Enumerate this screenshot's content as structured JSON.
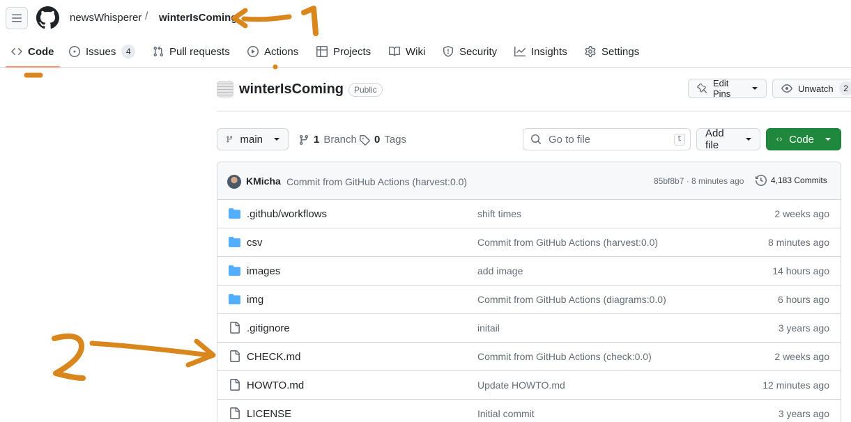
{
  "header": {
    "owner": "newsWhisperer",
    "separator": "/",
    "repo": "winterIsComing"
  },
  "tabs": [
    {
      "label": "Code",
      "icon": "code-icon",
      "selected": true
    },
    {
      "label": "Issues",
      "icon": "issue-icon",
      "count": "4"
    },
    {
      "label": "Pull requests",
      "icon": "pull-request-icon"
    },
    {
      "label": "Actions",
      "icon": "play-icon"
    },
    {
      "label": "Projects",
      "icon": "table-icon"
    },
    {
      "label": "Wiki",
      "icon": "book-icon"
    },
    {
      "label": "Security",
      "icon": "shield-icon"
    },
    {
      "label": "Insights",
      "icon": "graph-icon"
    },
    {
      "label": "Settings",
      "icon": "gear-icon"
    }
  ],
  "repo_header": {
    "title": "winterIsComing",
    "visibility": "Public",
    "edit_pins": "Edit Pins",
    "unwatch": "Unwatch",
    "watch_count": "2"
  },
  "file_nav": {
    "branch": "main",
    "branch_count": "1",
    "branch_label": "Branch",
    "tag_count": "0",
    "tag_label": "Tags",
    "go_to_file_placeholder": "Go to file",
    "shortcut_key": "t",
    "add_file": "Add file",
    "code": "Code"
  },
  "latest_commit": {
    "user": "KMicha",
    "message": "Commit from GitHub Actions (harvest:0.0)",
    "sha_time": "85bf8b7 · 8 minutes ago",
    "commits": "4,183 Commits"
  },
  "files": [
    {
      "type": "folder",
      "name": ".github/workflows",
      "message": "shift times",
      "age": "2 weeks ago"
    },
    {
      "type": "folder",
      "name": "csv",
      "message": "Commit from GitHub Actions (harvest:0.0)",
      "age": "8 minutes ago"
    },
    {
      "type": "folder",
      "name": "images",
      "message": "add image",
      "age": "14 hours ago"
    },
    {
      "type": "folder",
      "name": "img",
      "message": "Commit from GitHub Actions (diagrams:0.0)",
      "age": "6 hours ago"
    },
    {
      "type": "file",
      "name": ".gitignore",
      "message": "initail",
      "age": "3 years ago"
    },
    {
      "type": "file",
      "name": "CHECK.md",
      "message": "Commit from GitHub Actions (check:0.0)",
      "age": "2 weeks ago"
    },
    {
      "type": "file",
      "name": "HOWTO.md",
      "message": "Update HOWTO.md",
      "age": "12 minutes ago"
    },
    {
      "type": "file",
      "name": "LICENSE",
      "message": "Initial commit",
      "age": "3 years ago"
    }
  ],
  "colors": {
    "annotation": "#d9861c",
    "selected_tab_underline": "#fd8c73",
    "code_button": "#1f883d",
    "folder": "#54aeff"
  }
}
